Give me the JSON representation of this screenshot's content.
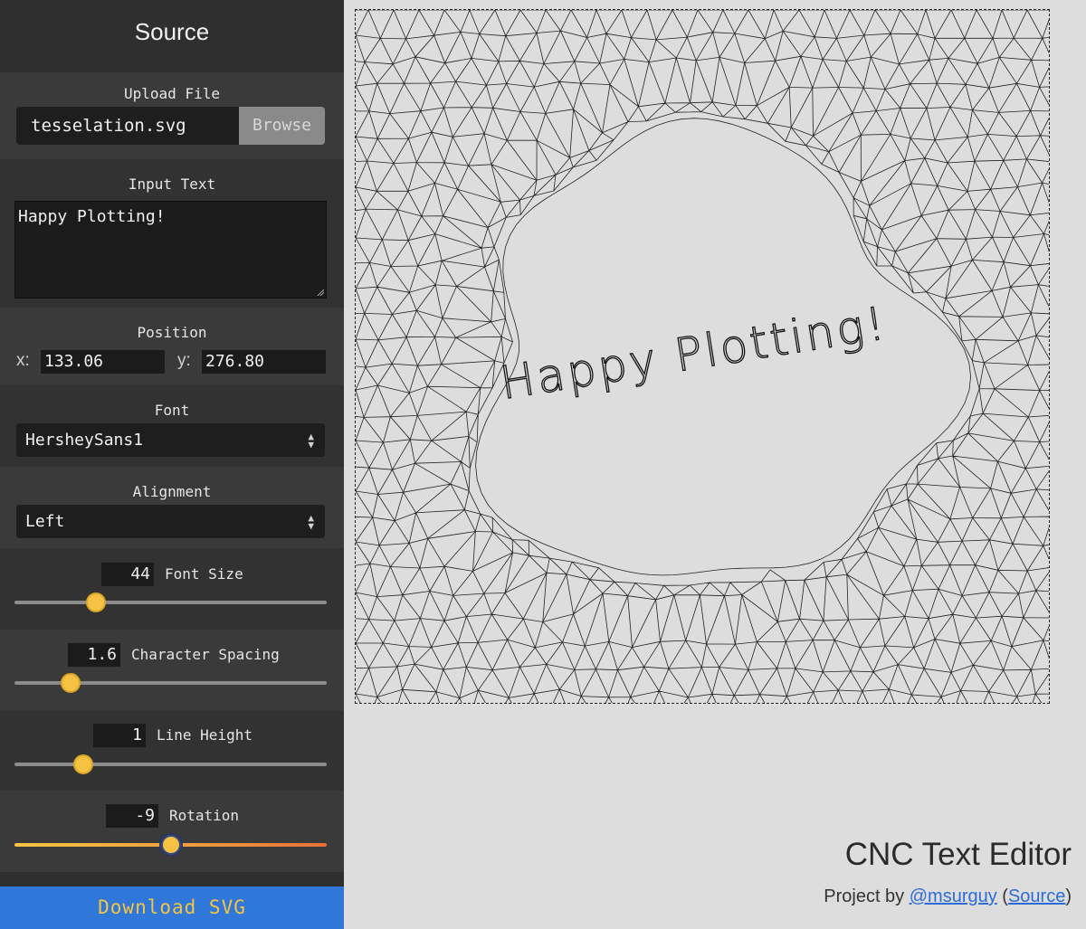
{
  "sidebar": {
    "title": "Source",
    "upload": {
      "label": "Upload File",
      "file_name": "tesselation.svg",
      "browse_label": "Browse"
    },
    "input_text": {
      "label": "Input Text",
      "value": "Happy Plotting!"
    },
    "position": {
      "label": "Position",
      "x_label": "x:",
      "x_value": "133.06",
      "y_label": "y:",
      "y_value": "276.80"
    },
    "font": {
      "label": "Font",
      "selected": "HersheySans1"
    },
    "alignment": {
      "label": "Alignment",
      "selected": "Left"
    },
    "font_size": {
      "label": "Font Size",
      "value": "44",
      "slider_fraction": 0.26
    },
    "char_spacing": {
      "label": "Character Spacing",
      "value": "1.6",
      "slider_fraction": 0.18
    },
    "line_height": {
      "label": "Line Height",
      "value": "1",
      "slider_fraction": 0.22
    },
    "rotation": {
      "label": "Rotation",
      "value": "-9",
      "slider_fraction": 0.5
    },
    "download_label": "Download SVG"
  },
  "canvas": {
    "text": "Happy Plotting!",
    "rotation_deg": -9
  },
  "footer": {
    "title": "CNC Text Editor",
    "credit_prefix": "Project by ",
    "author_link": "@msurguy",
    "paren_open": " (",
    "source_link": "Source",
    "paren_close": ")"
  },
  "colors": {
    "slider_thumb": "#f6c244",
    "download_bg": "#2f77d9",
    "download_text": "#f4c542",
    "canvas_bg": "#dddddd",
    "link": "#2c6bd8"
  }
}
